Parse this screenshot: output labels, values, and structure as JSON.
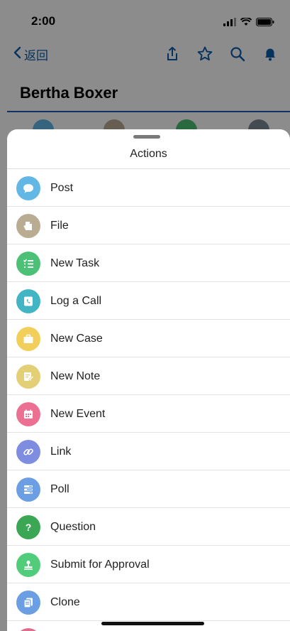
{
  "status_bar": {
    "time": "2:00"
  },
  "nav": {
    "back_label": "返回"
  },
  "record": {
    "title": "Bertha Boxer"
  },
  "sheet": {
    "title": "Actions",
    "actions": [
      {
        "label": "Post",
        "color": "#62b7e5",
        "icon": "comment-icon"
      },
      {
        "label": "File",
        "color": "#baac93",
        "icon": "file-icon"
      },
      {
        "label": "New Task",
        "color": "#4bc076",
        "icon": "task-list-icon"
      },
      {
        "label": "Log a Call",
        "color": "#41b5c4",
        "icon": "phone-log-icon"
      },
      {
        "label": "New Case",
        "color": "#f2cf5b",
        "icon": "briefcase-icon"
      },
      {
        "label": "New Note",
        "color": "#e3d076",
        "icon": "note-edit-icon"
      },
      {
        "label": "New Event",
        "color": "#eb7092",
        "icon": "calendar-icon"
      },
      {
        "label": "Link",
        "color": "#7f8de1",
        "icon": "link-icon"
      },
      {
        "label": "Poll",
        "color": "#6b9ee2",
        "icon": "poll-icon"
      },
      {
        "label": "Question",
        "color": "#3ba755",
        "icon": "question-icon"
      },
      {
        "label": "Submit for Approval",
        "color": "#50cc7a",
        "icon": "approval-stamp-icon"
      },
      {
        "label": "Clone",
        "color": "#6b9ee2",
        "icon": "clone-icon"
      }
    ]
  },
  "colors": {
    "brand_blue": "#1b5cb3",
    "overlay": "rgba(0,0,0,0.45)"
  }
}
